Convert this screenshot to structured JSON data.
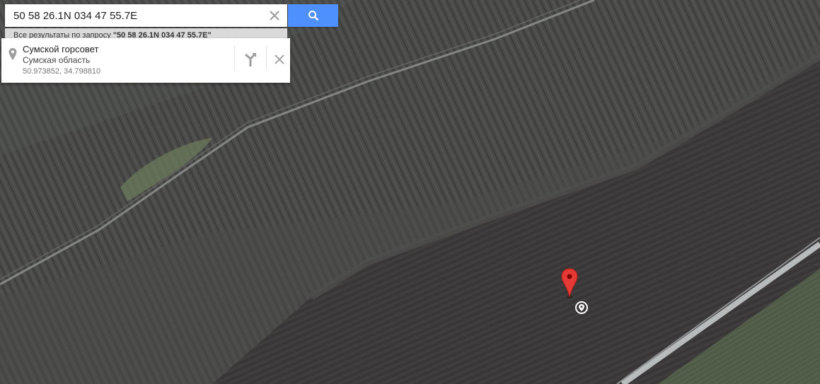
{
  "search": {
    "query": "50 58 26.1N 034 47 55.7E",
    "all_results_prefix": "Все результаты по запросу ",
    "all_results_query": "\"50 58 26.1N 034 47 55.7E\""
  },
  "result": {
    "title": "Сумской горсовет",
    "region": "Сумская область",
    "coords": "50.973852, 34.798810"
  },
  "icons": {
    "clear": "close-icon",
    "search": "search-icon",
    "place": "place-pin-icon",
    "directions": "directions-icon",
    "close": "close-icon",
    "marker": "red-map-marker",
    "white_marker": "location-marker"
  },
  "colors": {
    "search_button": "#4d90fe",
    "marker": "#e53935",
    "forest": "#4b4c4a",
    "field": "#3a3838",
    "grass": "#4d5845",
    "road": "#b9bcbc"
  }
}
